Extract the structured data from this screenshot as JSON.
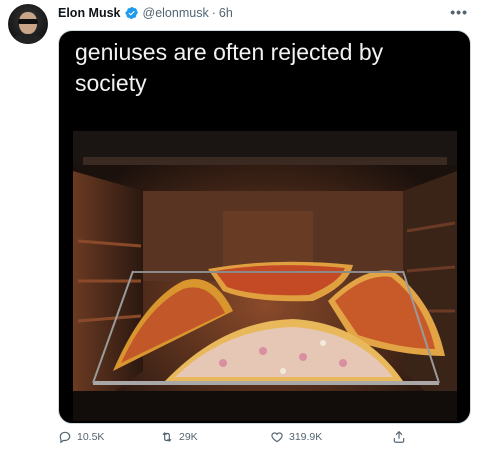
{
  "tweet": {
    "author_name": "Elon Musk",
    "handle": "@elonmusk",
    "separator": "·",
    "time": "6h",
    "more_icon": "more-horizontal-icon",
    "caption": "geniuses are often rejected by society"
  },
  "actions": {
    "replies": "10.5K",
    "retweets": "29K",
    "likes": "319.9K",
    "reply_icon": "reply-icon",
    "retweet_icon": "retweet-icon",
    "like_icon": "heart-icon",
    "share_icon": "share-icon"
  },
  "colors": {
    "verified": "#1d9bf0",
    "secondary_text": "#536471",
    "media_background": "#000000"
  }
}
